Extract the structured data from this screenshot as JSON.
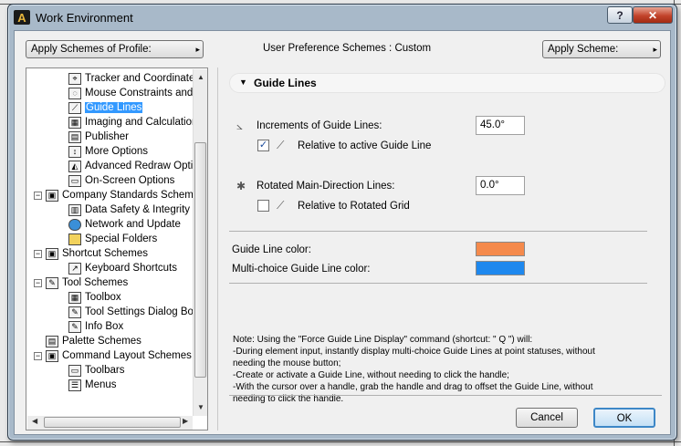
{
  "window": {
    "title": "Work Environment",
    "help_label": "?",
    "close_label": "✕"
  },
  "toolbar": {
    "apply_profile_label": "Apply Schemes of Profile:",
    "user_pref_label": "User Preference Schemes : Custom",
    "apply_scheme_label": "Apply Scheme:"
  },
  "tree": {
    "items": [
      {
        "label": "Tracker and Coordinate I",
        "icon": "tracker-icon"
      },
      {
        "label": "Mouse Constraints and M",
        "icon": "mouse-icon"
      },
      {
        "label": "Guide Lines",
        "icon": "guide-lines-icon"
      },
      {
        "label": "Imaging and Calculation",
        "icon": "imaging-icon"
      },
      {
        "label": "Publisher",
        "icon": "publisher-icon"
      },
      {
        "label": "More Options",
        "icon": "options-icon"
      },
      {
        "label": "Advanced Redraw Option",
        "icon": "redraw-icon"
      },
      {
        "label": "On-Screen Options",
        "icon": "screen-icon"
      },
      {
        "label": "Company Standards Scheme",
        "icon": "company-standards-icon"
      },
      {
        "label": "Data Safety & Integrity",
        "icon": "data-safety-icon"
      },
      {
        "label": "Network and Update",
        "icon": "network-icon"
      },
      {
        "label": "Special Folders",
        "icon": "folder-icon"
      },
      {
        "label": "Shortcut Schemes",
        "icon": "shortcut-schemes-icon"
      },
      {
        "label": "Keyboard Shortcuts",
        "icon": "keyboard-icon"
      },
      {
        "label": "Tool Schemes",
        "icon": "tool-schemes-icon"
      },
      {
        "label": "Toolbox",
        "icon": "toolbox-icon"
      },
      {
        "label": "Tool Settings Dialog Boxe",
        "icon": "tool-settings-icon"
      },
      {
        "label": "Info Box",
        "icon": "info-box-icon"
      },
      {
        "label": "Palette Schemes",
        "icon": "palette-icon"
      },
      {
        "label": "Command Layout Schemes",
        "icon": "command-layout-icon"
      },
      {
        "label": "Toolbars",
        "icon": "toolbars-icon"
      },
      {
        "label": "Menus",
        "icon": "menus-icon"
      }
    ]
  },
  "panel": {
    "section_title": "Guide Lines",
    "increments_label": "Increments of Guide Lines:",
    "increments_value": "45.0°",
    "relative_active_label": "Relative to active Guide Line",
    "rotated_label": "Rotated Main-Direction Lines:",
    "rotated_value": "0.0°",
    "relative_grid_label": "Relative to Rotated Grid",
    "guide_color_label": "Guide Line color:",
    "multi_color_label": "Multi-choice Guide Line color:",
    "guide_color": "#f58a4c",
    "multi_color": "#1e88ee",
    "note_lines": [
      "Note: Using the \"Force Guide Line Display\" command (shortcut: \" Q \") will:",
      "-During element input, instantly display multi-choice Guide Lines at point statuses, without",
      "needing the mouse button;",
      "-Create or activate a Guide Line, without needing to click the handle;",
      "-With the cursor over a handle, grab the handle and drag to offset the Guide Line, without",
      "needing to click the handle."
    ]
  },
  "footer": {
    "cancel_label": "Cancel",
    "ok_label": "OK"
  }
}
